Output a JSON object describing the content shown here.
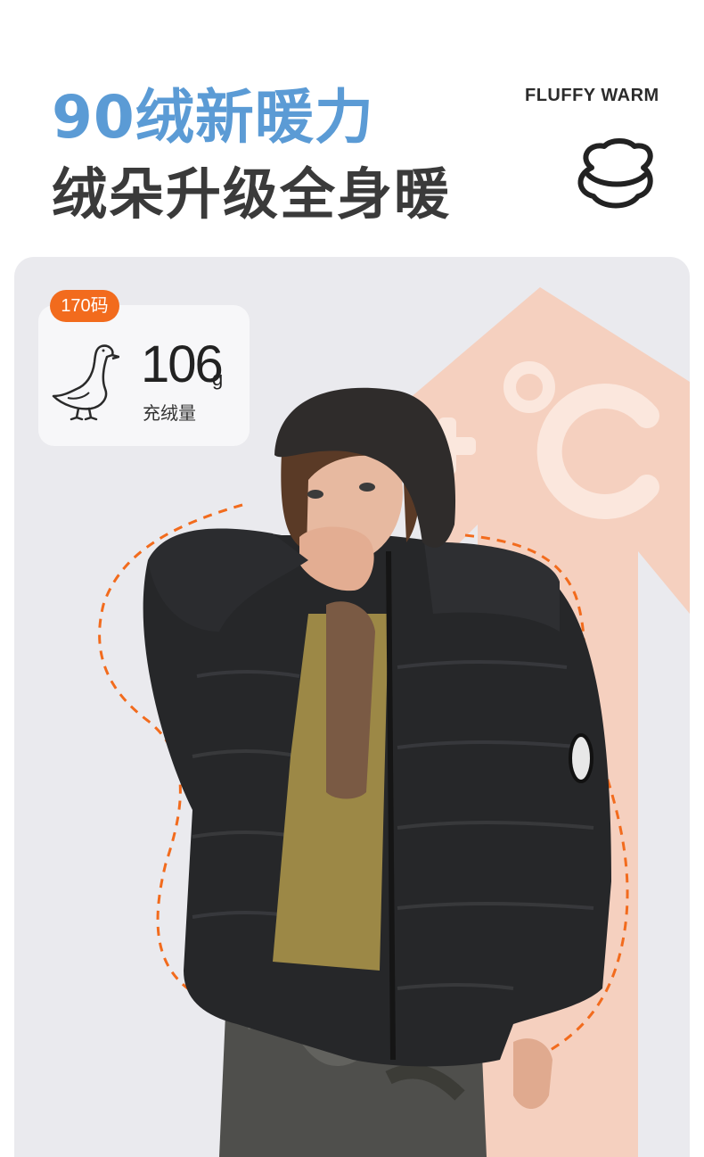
{
  "header": {
    "title_line1": "90绒新暖力",
    "title_line2": "绒朵升级全身暖",
    "english_tag": "FLUFFY WARM",
    "icon": "cloud-icon"
  },
  "fill_card": {
    "size_badge": "170码",
    "value": "106",
    "unit": "g",
    "label": "充绒量",
    "icon": "goose-icon"
  },
  "backdrop_graphic": {
    "text": "+°C",
    "icon": "temperature-arrow-icon"
  },
  "colors": {
    "title_blue": "#5b9bd5",
    "title_dark": "#3a3a3a",
    "accent_orange": "#f26b1d",
    "arrow_peach": "#f6cfbc",
    "panel_gray": "#eaeaee"
  }
}
